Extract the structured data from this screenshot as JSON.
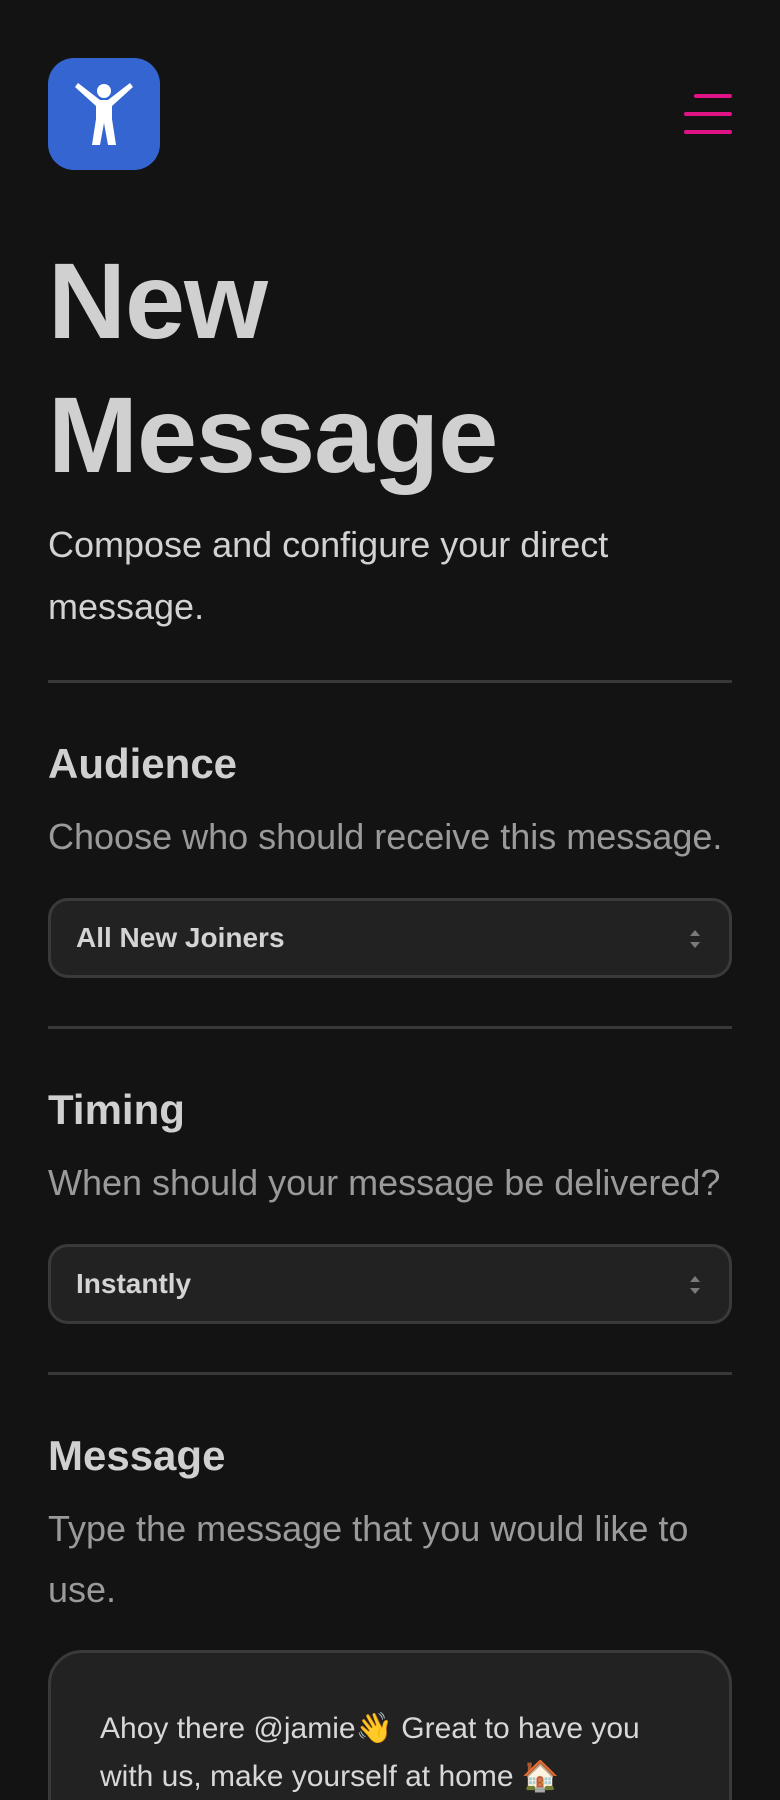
{
  "header": {
    "logo_icon": "person-arms-raised-icon",
    "logo_color": "#3465d1",
    "menu_icon": "hamburger-menu-icon",
    "accent_color": "#e01386"
  },
  "page": {
    "title_line1": "New",
    "title_line2": "Message",
    "subtitle": "Compose and configure your direct message."
  },
  "audience": {
    "title": "Audience",
    "description": "Choose who should receive this message.",
    "selected": "All New Joiners",
    "caret_icon": "select-caret-icon"
  },
  "timing": {
    "title": "Timing",
    "description": "When should your message be delivered?",
    "selected": "Instantly",
    "caret_icon": "select-caret-icon"
  },
  "message": {
    "title": "Message",
    "description": "Type the message that you would like to use.",
    "value": "Ahoy there @jamie👋 Great to have you with us, make yourself at home 🏠"
  }
}
